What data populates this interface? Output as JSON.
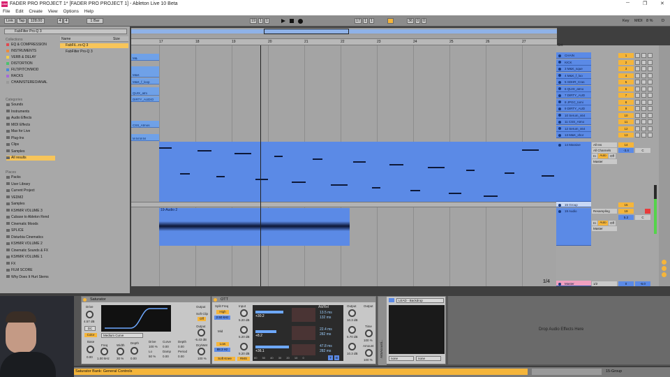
{
  "window": {
    "app_badge": "Live",
    "title": "FADER PRO PROJECT 1* [FADER PRO PROJECT 1] - Ableton Live 10 Beta",
    "minimize": "─",
    "maximize": "❐",
    "close": "✕"
  },
  "menu": [
    "File",
    "Edit",
    "Create",
    "View",
    "Options",
    "Help"
  ],
  "transport": {
    "link": "Link",
    "tap": "Tap",
    "tempo": "128.00",
    "sig_num": "4",
    "sig_den": "4",
    "quantize": "1 Bar",
    "pos_bar": "19",
    "pos_beat": "1",
    "pos_sixteenth": "1",
    "loop_bar": "17",
    "loop_beat": "1",
    "loop_sixteenth": "1",
    "loop_len": "36",
    "loop_len_beat": "0",
    "loop_len_six": "0",
    "key": "Key",
    "midi": "MIDI",
    "cpu": "8 %",
    "d_flag": "D"
  },
  "browser": {
    "search_value": "FabFilter Pro-Q 3",
    "collections_header": "Collections",
    "collections": [
      {
        "label": "EQ & COMPRESSION",
        "color": "#e0494f"
      },
      {
        "label": "INSTRUMENTS",
        "color": "#f08a3a"
      },
      {
        "label": "VERB & DELAY",
        "color": "#f2d04a"
      },
      {
        "label": "DISTORTION",
        "color": "#4bc26d"
      },
      {
        "label": "FILT/PITCH/MOD",
        "color": "#4a8ad8"
      },
      {
        "label": "RACKS",
        "color": "#a56ad8"
      },
      {
        "label": "CHAIN/STEREO/ANAL",
        "color": "#9a9a9a"
      }
    ],
    "categories_header": "Categories",
    "categories": [
      "Sounds",
      "Instruments",
      "Audio Effects",
      "MIDI Effects",
      "Max for Live",
      "Plug-Ins",
      "Clips",
      "Samples",
      "All results"
    ],
    "places_header": "Places",
    "places": [
      "Packs",
      "User Library",
      "Current Project",
      "VEDM2",
      "Samples",
      "KSHMR VOLUME 3",
      "Cubase to Ableton Rend",
      "Cinematic Moods",
      "SPLICE",
      "Disturbia Cinematics",
      "KSHMR VOLUME 2",
      "Cinematic Sounds & FX",
      "KSHMR VOLUME 1",
      "FX",
      "FILM SCORE",
      "Why Does It Hurt Stems"
    ],
    "col_name": "Name",
    "col_size": "Size",
    "results": [
      "FabFil...ro-Q 3",
      "FabFilter Pro-Q 3"
    ]
  },
  "arrangement": {
    "ruler": [
      "17",
      "18",
      "19",
      "20",
      "21",
      "22",
      "23",
      "24",
      "25",
      "26",
      "27"
    ],
    "time_ruler": [
      "0:30",
      "0:32",
      "0:34",
      "0:36",
      "0:38",
      "0:40",
      "0:42",
      "0:44",
      "0:46",
      "0:48",
      "0:50"
    ],
    "left_clips": [
      "M&",
      "MI",
      "M&K",
      "M&K_f_loop",
      "QUIX_atm",
      "QU",
      "DIRTY_AUDIO",
      "CSS_Atmos",
      "M M M M",
      "M"
    ],
    "audio_clip_name": "19-Audio 2",
    "zoom_fraction": "1/4",
    "set_label": "Set"
  },
  "tracks": [
    {
      "name": "CHAIN",
      "num": "1"
    },
    {
      "name": "KICK",
      "num": "2"
    },
    {
      "name": "3 M&K_sque",
      "num": "3"
    },
    {
      "name": "4 M&K_f_loo",
      "num": "4"
    },
    {
      "name": "5 SDHR_Cras",
      "num": "5"
    },
    {
      "name": "6 QUIX_atmo",
      "num": "6"
    },
    {
      "name": "7 DIRTY_AUD",
      "num": "7"
    },
    {
      "name": "8 JPGC_tomi",
      "num": "8"
    },
    {
      "name": "9 DIRTY_AUD",
      "num": "9"
    },
    {
      "name": "10 Serum_s64",
      "num": "10"
    },
    {
      "name": "11 CSS_Atmo",
      "num": "11"
    },
    {
      "name": "12 Serum_s64",
      "num": "12"
    },
    {
      "name": "13 M&K_shor",
      "num": "13"
    },
    {
      "name": "14 Massive",
      "num": "14"
    }
  ],
  "massive_io": {
    "input": "All Ins",
    "channel": "All Channels",
    "in": "In",
    "auto": "Auto",
    "off": "Off",
    "out": "Master",
    "vol": "-3.4",
    "pan": "C"
  },
  "group_track": {
    "name": "15 Group",
    "num": "15"
  },
  "audio_track": {
    "name": "19 Audio",
    "num": "19",
    "input": "Resampling",
    "in": "In",
    "auto": "Auto",
    "off": "Off",
    "out": "Master",
    "vol": "5.2",
    "pan": "C"
  },
  "master": {
    "name": "Master",
    "fraction": "1/2",
    "vol": "0",
    "pan": "-6.0"
  },
  "devices": {
    "saturator": {
      "title": "Saturator",
      "drive_label": "Drive",
      "drive": "4.57 dB",
      "dc": "DC",
      "color": "Color",
      "type": "Medium Curve",
      "base": "Base",
      "base_val": "0.00",
      "freq": "Freq",
      "freq_val": "1.00 kHz",
      "width": "Width",
      "width_val": "30 %",
      "depth": "Depth",
      "depth_val": "0.00",
      "drive2": "Drive",
      "drive2_val": "100 %",
      "curve": "Curve",
      "curve_val": "0.00",
      "lo": "Lo",
      "lo_val": "50 %",
      "damp": "Damp",
      "damp_val": "0.00",
      "depth2": "Depth",
      "depth2_val": "0.00",
      "period": "Period",
      "period_val": "0.00",
      "output": "Output",
      "soft_clip": "Soft Clip",
      "soft_clip_btn": "Off",
      "output2": "Output",
      "output_val": "-5.43 dB",
      "dry_wet": "Dry/Wet",
      "dry_wet_val": "100 %"
    },
    "ott": {
      "title": "OTT",
      "split_freq": "Split Freq",
      "input": "Input",
      "high": "High",
      "high_freq": "2.50 kHz",
      "high_in": "5.20 dB",
      "mid": "Mid",
      "mid_in": "5.20 dB",
      "low": "Low",
      "low_freq": "88.3 Hz",
      "low_in": "5.20 dB",
      "soft_knee": "Soft Knee",
      "rms": "RMS",
      "att_rel": "Att/Rel",
      "high_att": "13.5 ms",
      "high_rel": "132 ms",
      "mid_att": "22.4 ms",
      "mid_rel": "282 ms",
      "low_att": "47.8 ms",
      "low_rel": "282 ms",
      "output": "Output",
      "out_high": "10.3 dB",
      "out_mid": "5.70 dB",
      "out_low": "10.3 dB",
      "time": "Time",
      "time_val": "100 %",
      "amount": "Amount",
      "amount_val": "100 %",
      "high_meter": "+30.2",
      "mid_meter": "+8.2",
      "low_meter": "+36.1",
      "scale": [
        "60",
        "50",
        "40",
        "30",
        "20",
        "10",
        "0"
      ],
      "t_btn": "T",
      "b_btn": "B"
    },
    "arts": {
      "title": "ArtsAcousti...",
      "side_label": "ArtsAcousti...",
      "preset": "LEAD - Backdrop",
      "sel1": "none",
      "sel2": "none"
    },
    "drop_hint": "Drop Audio Effects Here"
  },
  "status": {
    "text": "Saturator Bank: General Controls",
    "track": "15-Group"
  }
}
